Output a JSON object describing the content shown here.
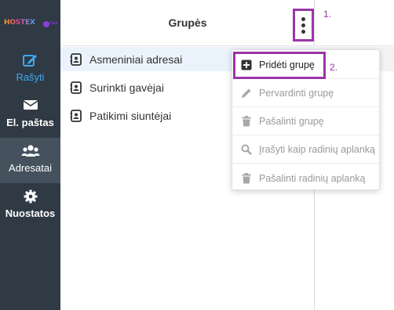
{
  "brand": {
    "logo_text": "HOSTEX",
    "logo_sub": "hex"
  },
  "sidebar": {
    "items": [
      {
        "label": "Rašyti",
        "icon": "compose-icon"
      },
      {
        "label": "El. paštas",
        "icon": "envelope-icon"
      },
      {
        "label": "Adresatai",
        "icon": "users-icon"
      },
      {
        "label": "Nuostatos",
        "icon": "gear-icon"
      }
    ]
  },
  "groups": {
    "title": "Grupės",
    "items": [
      {
        "label": "Asmeniniai adresai"
      },
      {
        "label": "Surinkti gavėjai"
      },
      {
        "label": "Patikimi siuntėjai"
      }
    ]
  },
  "menu": {
    "items": [
      {
        "label": "Pridėti grupę",
        "icon": "plus-square-icon",
        "enabled": true
      },
      {
        "label": "Pervardinti grupę",
        "icon": "pencil-icon",
        "enabled": false
      },
      {
        "label": "Pašalinti grupę",
        "icon": "trash-icon",
        "enabled": false
      },
      {
        "label": "Įrašyti kaip radinių aplanką",
        "icon": "search-icon",
        "enabled": false
      },
      {
        "label": "Pašalinti radinių aplanką",
        "icon": "trash-icon",
        "enabled": false
      }
    ]
  },
  "annotations": {
    "step1": "1.",
    "step2": "2."
  },
  "colors": {
    "sidebar_bg": "#2f3a44",
    "accent": "#3fa9f5",
    "annotation": "#9b35a8"
  }
}
